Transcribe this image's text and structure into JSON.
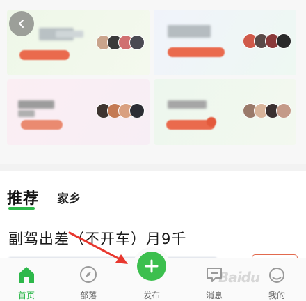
{
  "tabs": {
    "primary": "推荐",
    "secondary": "家乡"
  },
  "article": {
    "title": "副驾出差（不开车）月9千"
  },
  "bottom_nav": {
    "items": [
      {
        "label": "首页",
        "icon": "home-icon",
        "active": true
      },
      {
        "label": "部落",
        "icon": "compass-icon",
        "active": false
      },
      {
        "label": "发布",
        "icon": "plus-icon",
        "active": false
      },
      {
        "label": "消息",
        "icon": "message-icon",
        "active": false
      },
      {
        "label": "我的",
        "icon": "profile-icon",
        "active": false
      }
    ]
  },
  "colors": {
    "accent": "#2db84a",
    "publish": "#3cbf4e",
    "arrow": "#e8372e"
  },
  "watermark": "Baidu"
}
